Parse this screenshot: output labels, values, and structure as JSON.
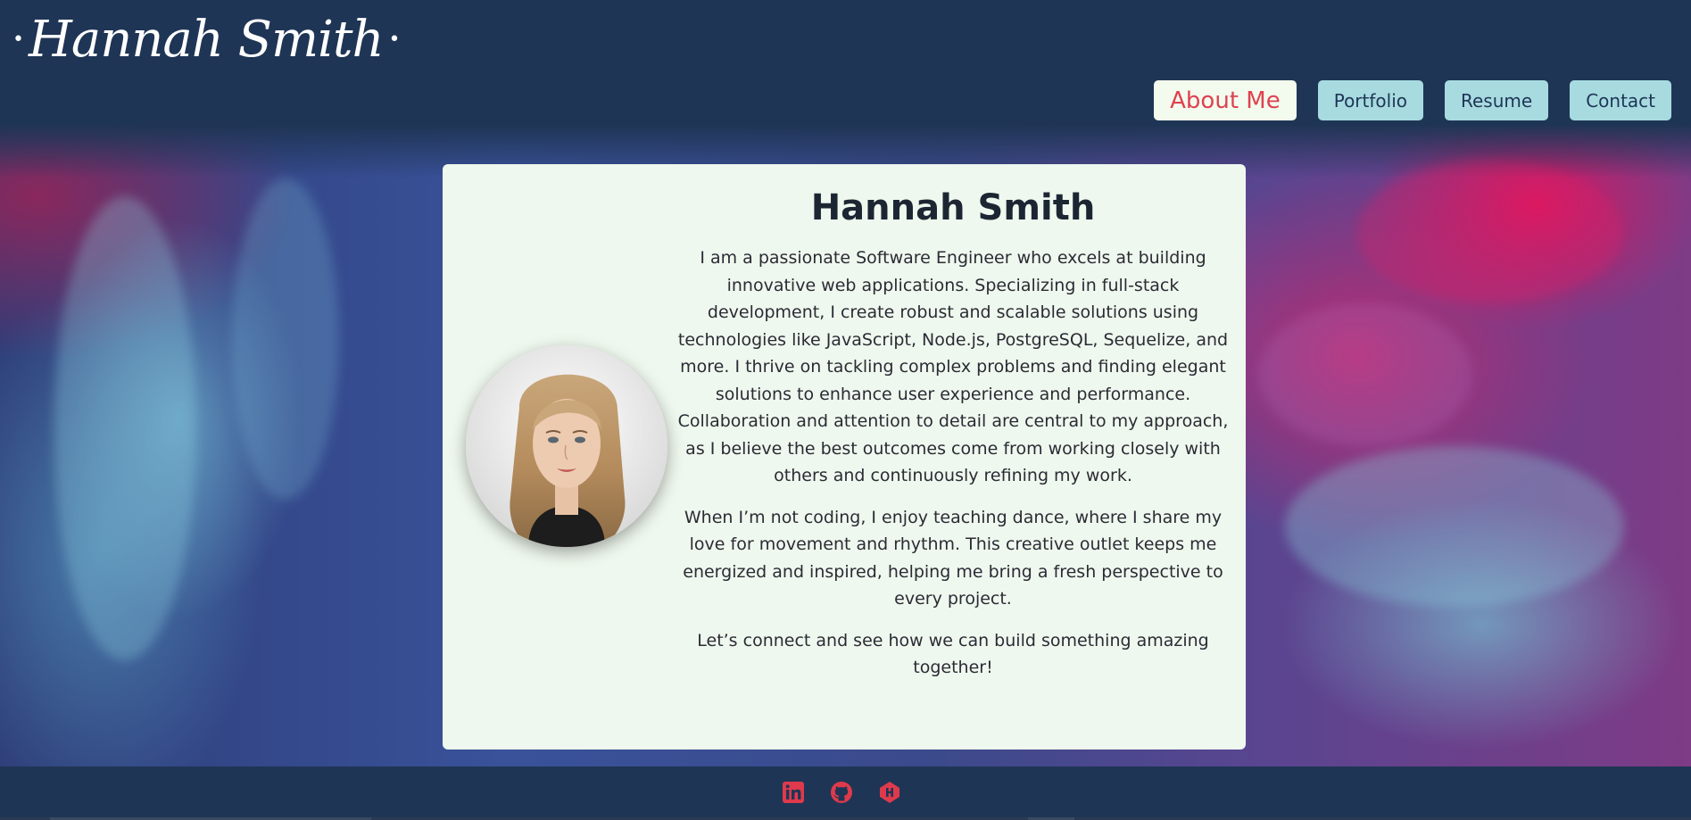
{
  "header": {
    "logo_text": "Hannah Smith",
    "nav": [
      {
        "label": "About Me",
        "active": true
      },
      {
        "label": "Portfolio",
        "active": false
      },
      {
        "label": "Resume",
        "active": false
      },
      {
        "label": "Contact",
        "active": false
      }
    ]
  },
  "about": {
    "name": "Hannah Smith",
    "paragraphs": [
      "I am a passionate Software Engineer who excels at building innovative web applications. Specializing in full-stack development, I create robust and scalable solutions using technologies like JavaScript, Node.js, PostgreSQL, Sequelize, and more. I thrive on tackling complex problems and finding elegant solutions to enhance user experience and performance. Collaboration and attention to detail are central to my approach, as I believe the best outcomes come from working closely with others and continuously refining my work.",
      "When I’m not coding, I enjoy teaching dance, where I share my love for movement and rhythm. This creative outlet keeps me energized and inspired, helping me bring a fresh perspective to every project.",
      "Let’s connect and see how we can build something amazing together!"
    ]
  },
  "footer": {
    "social_icons": [
      "linkedin-icon",
      "github-icon",
      "hashnode-icon"
    ]
  },
  "colors": {
    "header_bg": "#1f3555",
    "nav_button_bg": "#a7dbe0",
    "nav_active_bg": "#f3fbee",
    "nav_active_text": "#de4251",
    "card_bg": "#eff8ee",
    "social_icon": "#de3a4c"
  }
}
